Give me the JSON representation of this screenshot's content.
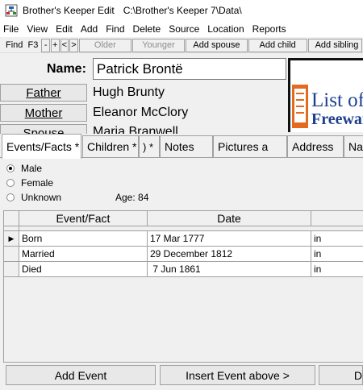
{
  "window": {
    "app_title": "Brother's Keeper Edit",
    "path": "C:\\Brother's Keeper 7\\Data\\"
  },
  "menu": [
    "File",
    "View",
    "Edit",
    "Add",
    "Find",
    "Delete",
    "Source",
    "Location",
    "Reports"
  ],
  "toolbar": {
    "find_label": "Find  F3",
    "buttons": [
      "-",
      "+",
      "<",
      ">",
      "Older",
      "Younger",
      "Add spouse",
      "Add child",
      "Add sibling"
    ]
  },
  "person": {
    "name_label": "Name:",
    "name_value": "Patrick Brontë",
    "father_label": "Father",
    "father_value": "Hugh Brunty",
    "mother_label": "Mother",
    "mother_value": "Eleanor McClory",
    "spouse_label": "Spouse",
    "spouse_value": "Maria Branwell"
  },
  "photo": {
    "line1": "List of",
    "line2": "Freeware"
  },
  "tabs": [
    "Events/Facts *",
    "Children *",
    "Notes",
    "Pictures a",
    "Address",
    "Na"
  ],
  "gender": {
    "options": [
      "Male",
      "Female",
      "Unknown"
    ],
    "selected": "Male",
    "age_text": "Age: 84"
  },
  "events_table": {
    "columns": [
      "Event/Fact",
      "Date",
      ""
    ],
    "rows": [
      {
        "event": "Born",
        "date": "17 Mar 1777",
        "place": "in"
      },
      {
        "event": "Married",
        "date": "29 December 1812",
        "place": "in"
      },
      {
        "event": "Died",
        "date": " 7 Jun 1861",
        "place": "in"
      }
    ],
    "current_row_marker": "▶"
  },
  "bottom_buttons": {
    "add_event": "Add Event",
    "insert_event": "Insert Event above >",
    "delete": "D"
  },
  "colors": {
    "title_bar": "#ffffff",
    "tab_active": "#ffffff",
    "photo_orange": "#e36a1e",
    "photo_blue": "#1c3f8f"
  }
}
